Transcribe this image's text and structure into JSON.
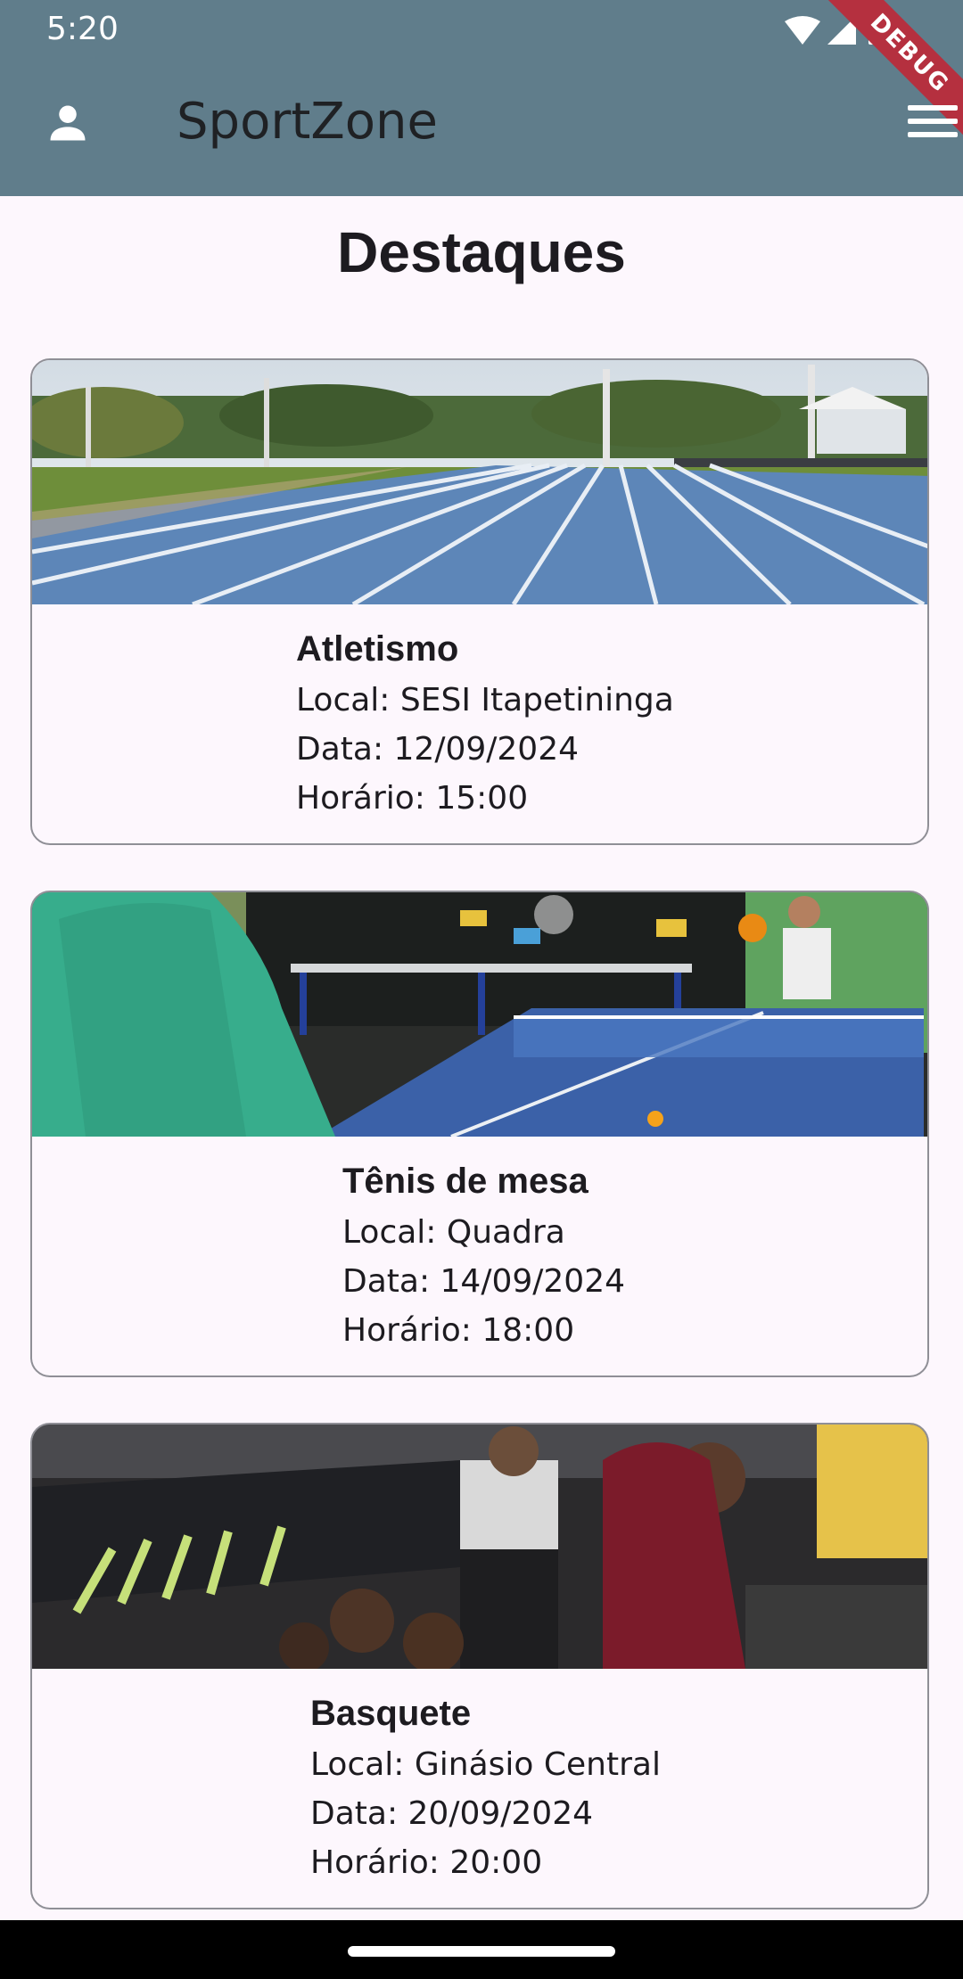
{
  "status_bar": {
    "time": "5:20"
  },
  "debug_banner": "DEBUG",
  "app_bar": {
    "title": "SportZone"
  },
  "page": {
    "heading": "Destaques"
  },
  "events": [
    {
      "title": "Atletismo",
      "local": "Local: SESI Itapetininga",
      "data": "Data: 12/09/2024",
      "horario": "Horário: 15:00"
    },
    {
      "title": "Tênis de mesa",
      "local": "Local: Quadra",
      "data": "Data: 14/09/2024",
      "horario": "Horário: 18:00"
    },
    {
      "title": "Basquete",
      "local": "Local: Ginásio Central",
      "data": "Data: 20/09/2024",
      "horario": "Horário: 20:00"
    }
  ],
  "colors": {
    "app_bar": "#607d8b",
    "background": "#fdf7fd",
    "debug_ribbon": "#b5303f"
  },
  "icons": {
    "profile": "person-icon",
    "menu": "hamburger-menu-icon"
  }
}
